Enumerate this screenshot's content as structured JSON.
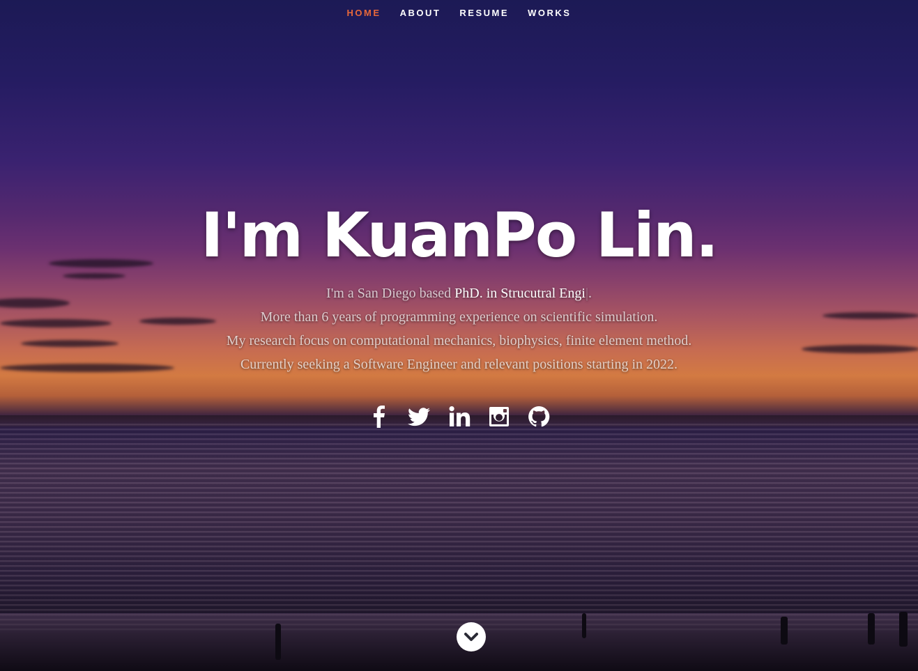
{
  "nav": {
    "items": [
      {
        "label": "HOME",
        "active": true
      },
      {
        "label": "ABOUT",
        "active": false
      },
      {
        "label": "RESUME",
        "active": false
      },
      {
        "label": "WORKS",
        "active": false
      }
    ],
    "active_color": "#e8683a"
  },
  "banner": {
    "headline": "I'm KuanPo Lin.",
    "line1_prefix": "I'm a San Diego based ",
    "line1_typed": "PhD. in Strucutral Engi",
    "line1_cursor": "|",
    "line1_suffix": ".",
    "line2": "More than 6 years of programming experience on scientific simulation.",
    "line3": "My research focus on computational mechanics, biophysics, finite element method.",
    "line4": "Currently seeking a Software Engineer and relevant positions starting in 2022."
  },
  "social": [
    {
      "icon": "facebook-icon"
    },
    {
      "icon": "twitter-icon"
    },
    {
      "icon": "linkedin-icon"
    },
    {
      "icon": "instagram-icon"
    },
    {
      "icon": "github-icon"
    }
  ],
  "scroll_down": {
    "icon": "chevron-down-icon"
  }
}
